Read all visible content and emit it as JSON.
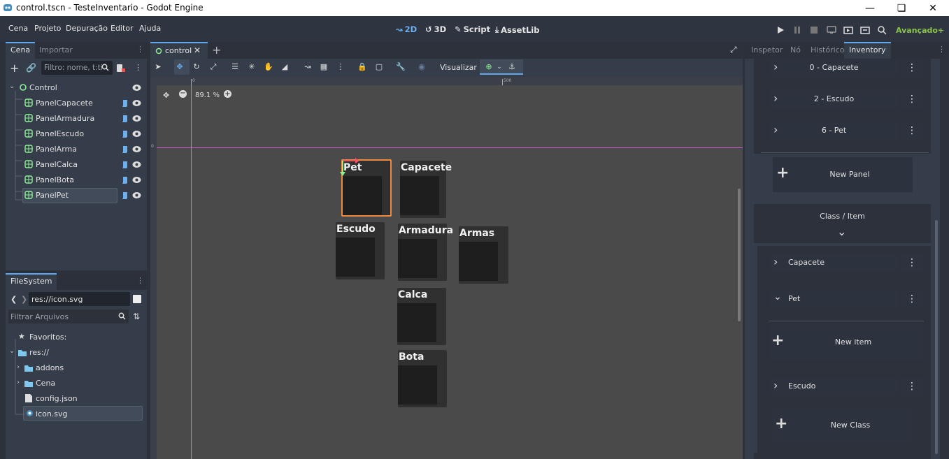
{
  "window": {
    "title": "control.tscn - TesteInventario - Godot Engine"
  },
  "menus": [
    "Cena",
    "Projeto",
    "Depuração",
    "Editor",
    "Ajuda"
  ],
  "workspaces": {
    "w2d": "2D",
    "w3d": "3D",
    "script": "Script",
    "assetlib": "AssetLib"
  },
  "renderer": "Avançado+",
  "scene_dock": {
    "tabs": [
      "Cena",
      "Importar"
    ],
    "filter_placeholder": "Filtro: nome, t:ti",
    "root": "Control",
    "nodes": [
      "PanelCapacete",
      "PanelArmadura",
      "PanelEscudo",
      "PanelArma",
      "PanelCalca",
      "PanelBota",
      "PanelPet"
    ],
    "selected": "PanelPet"
  },
  "filesystem": {
    "tab": "FileSystem",
    "path": "res://icon.svg",
    "filter_placeholder": "Filtrar Arquivos",
    "favorites": "Favoritos:",
    "root": "res://",
    "items": [
      "addons",
      "Cena",
      "config.json",
      "icon.svg"
    ],
    "selected": "icon.svg"
  },
  "editor": {
    "tab": "control",
    "visualizar": "Visualizar",
    "zoom": "89.1 %",
    "ruler_marks": [
      "0",
      "500"
    ]
  },
  "canvas_panels": [
    "Pet",
    "Capacete",
    "Escudo",
    "Armadura",
    "Armas",
    "Calca",
    "Bota"
  ],
  "right_dock": {
    "tabs": [
      "Inspetor",
      "Nó",
      "Histórico",
      "Inventory"
    ],
    "panel_items": [
      "0 - Capacete",
      "2 - Escudo",
      "6 - Pet"
    ],
    "new_panel": "New Panel",
    "class_item_header": "Class / Item",
    "classes": [
      {
        "label": "Capacete",
        "expanded": false
      },
      {
        "label": "Pet",
        "expanded": true
      },
      {
        "label": "Escudo",
        "expanded": false
      }
    ],
    "new_item": "New item",
    "new_class": "New Class"
  },
  "colors": {
    "accent": "#5fa8ee",
    "renderer": "#8bc34a",
    "selection": "#f0883e",
    "node_icon": "#8eef97"
  }
}
